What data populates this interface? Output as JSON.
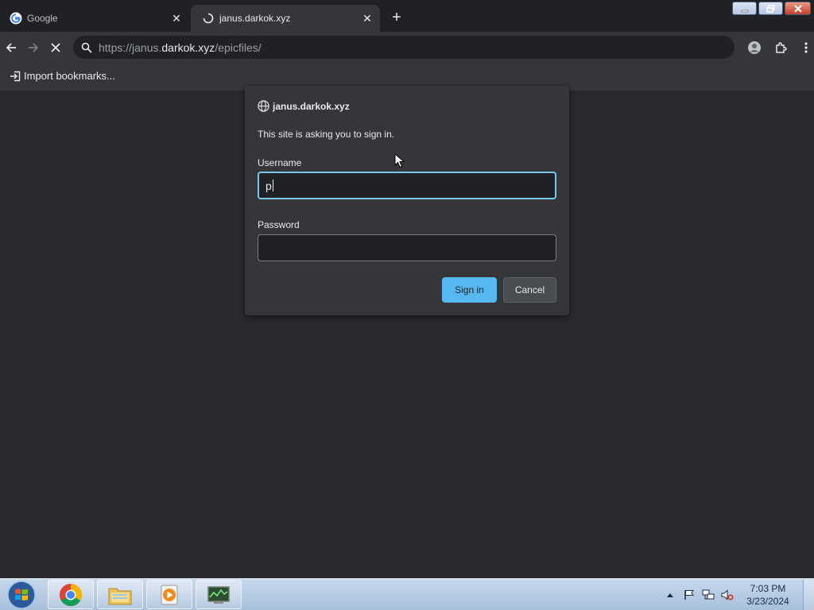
{
  "browser": {
    "tabs": [
      {
        "title": "Google",
        "favicon": "google-g-icon",
        "active": false
      },
      {
        "title": "janus.darkok.xyz",
        "favicon": "loading-spinner-icon",
        "active": true
      }
    ],
    "new_tab_icon": "plus-icon",
    "address": {
      "scheme": "https://janus.",
      "host": "darkok.xyz",
      "path": "/epicfiles/"
    },
    "bookmarks": {
      "import_label": "Import bookmarks..."
    }
  },
  "dialog": {
    "site": "janus.darkok.xyz",
    "message": "This site is asking you to sign in.",
    "username_label": "Username",
    "username_value": "p",
    "password_label": "Password",
    "password_value": "",
    "signin_label": "Sign in",
    "cancel_label": "Cancel"
  },
  "taskbar": {
    "apps": [
      "chrome",
      "windows-explorer",
      "media-player",
      "task-manager"
    ],
    "clock_time": "7:03 PM",
    "clock_date": "3/23/2024"
  },
  "colors": {
    "accent": "#79c8e8",
    "signin_button": "#56b8ef",
    "background": "#292a2d",
    "dialog": "#35363a"
  }
}
